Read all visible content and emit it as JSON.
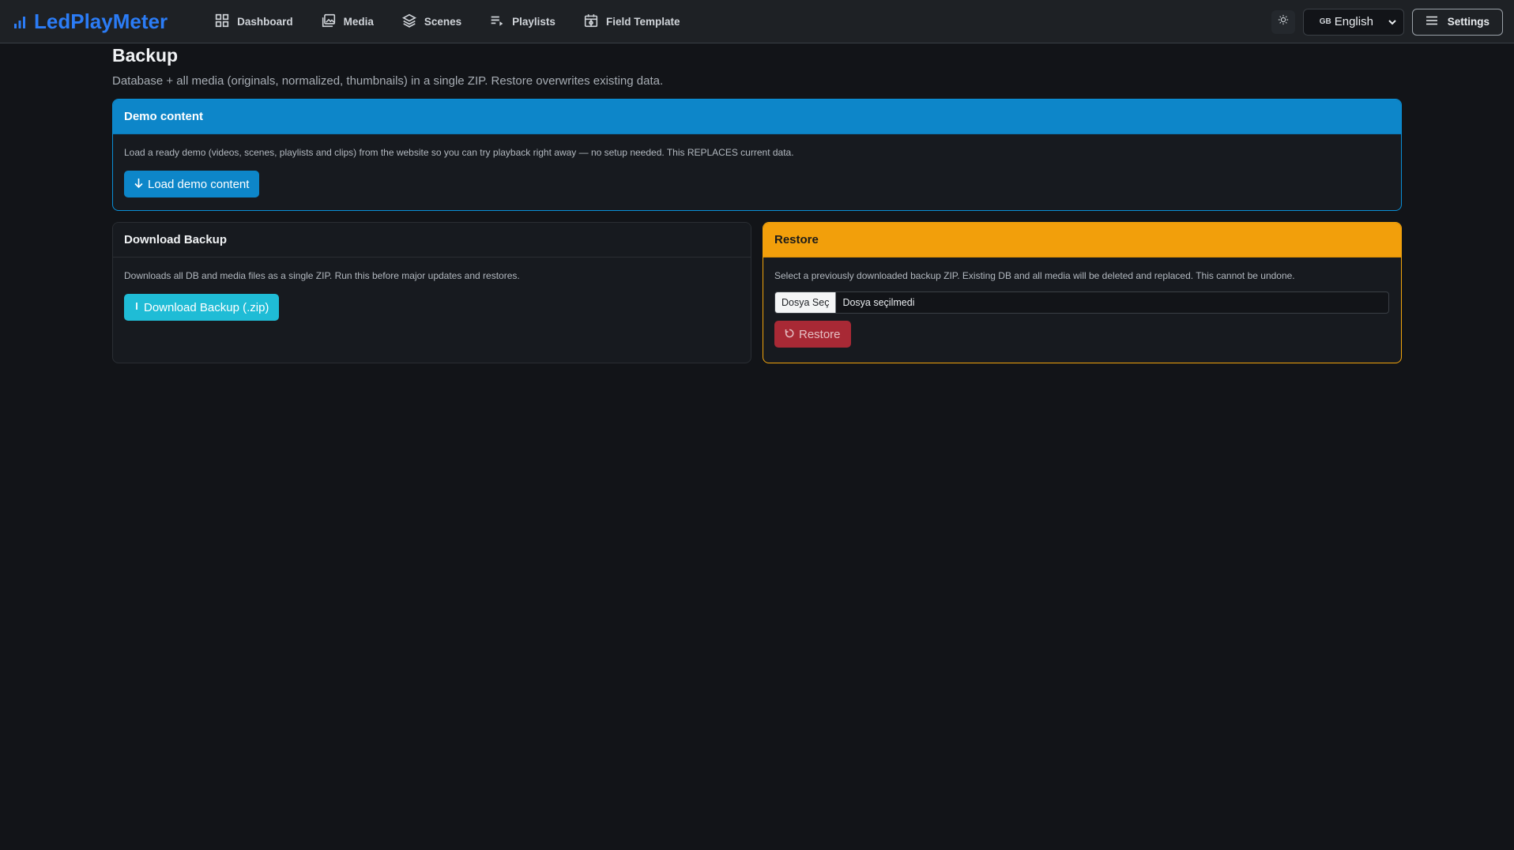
{
  "brand": {
    "name": "LedPlayMeter",
    "icon": "bar-chart-icon",
    "color": "#2b7cf6"
  },
  "nav": [
    {
      "label": "Dashboard",
      "icon": "grid-icon"
    },
    {
      "label": "Media",
      "icon": "images-icon"
    },
    {
      "label": "Scenes",
      "icon": "layers-icon"
    },
    {
      "label": "Playlists",
      "icon": "playlist-icon"
    },
    {
      "label": "Field Template",
      "icon": "field-template-icon"
    }
  ],
  "header_right": {
    "theme_icon": "sun-icon",
    "language": {
      "flag": "GB",
      "selected": "English"
    },
    "settings_label": "Settings"
  },
  "page": {
    "title": "Backup",
    "subtitle": "Database + all media (originals, normalized, thumbnails) in a single ZIP. Restore overwrites existing data."
  },
  "demo": {
    "title": "Demo content",
    "text": "Load a ready demo (videos, scenes, playlists and clips) from the website so you can try playback right away — no setup needed. This REPLACES current data.",
    "button": "Load demo content",
    "accent": "#0d86c9"
  },
  "download": {
    "title": "Download Backup",
    "text": "Downloads all DB and media files as a single ZIP. Run this before major updates and restores.",
    "button": "Download Backup (.zip)",
    "accent": "#1fbcd6"
  },
  "restore": {
    "title": "Restore",
    "text": "Select a previously downloaded backup ZIP. Existing DB and all media will be deleted and replaced. This cannot be undone.",
    "file_button": "Dosya Seç",
    "file_status": "Dosya seçilmedi",
    "button": "Restore",
    "accent": "#f29f0b",
    "danger": "#b02a37"
  }
}
